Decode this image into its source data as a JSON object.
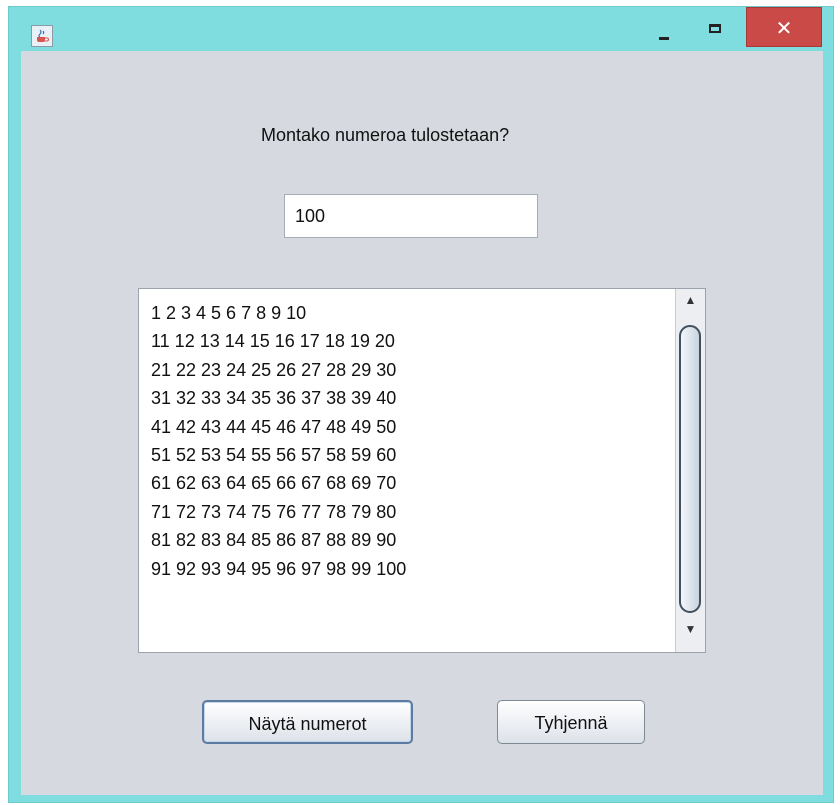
{
  "window": {
    "title": "",
    "app_icon": "java-cup-icon",
    "controls": {
      "minimize_icon": "minimize-icon",
      "maximize_icon": "maximize-icon",
      "close_icon": "close-icon",
      "close_glyph": "✕"
    },
    "colors": {
      "frame": "#7fdde0",
      "close": "#c94a47",
      "content": "#d6d9df"
    }
  },
  "form": {
    "prompt": "Montako numeroa tulostetaan?",
    "count_value": "100"
  },
  "output": {
    "lines": [
      "1 2 3 4 5 6 7 8 9 10",
      "11 12 13 14 15 16 17 18 19 20",
      "21 22 23 24 25 26 27 28 29 30",
      "31 32 33 34 35 36 37 38 39 40",
      "41 42 43 44 45 46 47 48 49 50",
      "51 52 53 54 55 56 57 58 59 60",
      "61 62 63 64 65 66 67 68 69 70",
      "71 72 73 74 75 76 77 78 79 80",
      "81 82 83 84 85 86 87 88 89 90",
      "91 92 93 94 95 96 97 98 99 100"
    ],
    "scroll": {
      "up_glyph": "▲",
      "down_glyph": "▼"
    }
  },
  "buttons": {
    "show_label": "Näytä numerot",
    "clear_label": "Tyhjennä"
  }
}
